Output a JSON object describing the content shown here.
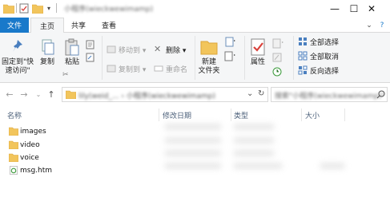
{
  "titlebar": {
    "title": "小程序(wieckwewimamp)",
    "quick_access_arrow": "▾",
    "controls": {
      "minimize": "—",
      "maximize": "☐",
      "close": "✕"
    }
  },
  "tabs": {
    "file": "文件",
    "home": "主页",
    "share": "共享",
    "view": "查看",
    "collapse_glyph": "⌄",
    "help_glyph": "?"
  },
  "ribbon": {
    "pin": "固定到\"快\n速访问\"",
    "copy": "复制",
    "paste": "粘贴",
    "move_to": "移动到 ▾",
    "copy_to": "复制到 ▾",
    "delete": "删除 ▾",
    "rename": "重命名",
    "new_folder": "新建\n文件夹",
    "properties": "属性",
    "select_all": "全部选择",
    "select_none": "全部取消",
    "invert_selection": "反向选择"
  },
  "nav": {
    "back": "←",
    "forward": "→",
    "up": "↑",
    "address": "lily(weid_...  ›  小程序(wieckwewimamp)",
    "address_dropdown": "⌄",
    "refresh": "↻",
    "search_placeholder": "搜索\"小程序(wieckwewimamp)\""
  },
  "columns": {
    "name": "名称",
    "date": "修改日期",
    "type": "类型",
    "size": "大小"
  },
  "files": [
    {
      "name": "images",
      "kind": "folder"
    },
    {
      "name": "video",
      "kind": "folder"
    },
    {
      "name": "voice",
      "kind": "folder"
    },
    {
      "name": "msg.htm",
      "kind": "htm"
    }
  ],
  "colors": {
    "accent": "#1979ca",
    "folder": "#f2c55c",
    "folder_dark": "#dca53a",
    "ribbon_bg": "#f5f6f7"
  }
}
